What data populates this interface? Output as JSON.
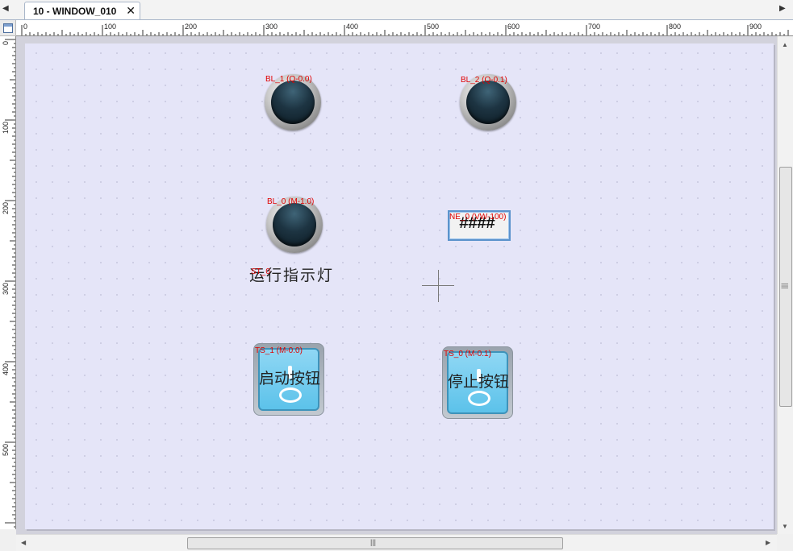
{
  "tab": {
    "title": "10 - WINDOW_010",
    "close": "✕"
  },
  "ruler": {
    "top_labels": [
      "0",
      "100",
      "200",
      "300",
      "400",
      "500",
      "600",
      "700",
      "800",
      "900"
    ],
    "left_labels": [
      "0",
      "100",
      "200",
      "300",
      "400",
      "500"
    ]
  },
  "widgets": {
    "bl1": {
      "label": "BL_1 (Q-0.0)"
    },
    "bl2": {
      "label": "BL_2 (Q-0.1)"
    },
    "bl0": {
      "label": "BL_0 (M-1.0)"
    },
    "ne0": {
      "label": "NE_0 (VW-100)",
      "value": "####"
    },
    "st0": {
      "label": "ST_0",
      "text": "运行指示灯"
    },
    "ts1": {
      "label": "TS_1 (M-0.0)",
      "text": "启动按钮"
    },
    "ts0": {
      "label": "TS_0 (M-0.1)",
      "text": "停止按钮"
    }
  },
  "scrollbars": {
    "grip_glyph": "|||"
  },
  "icons": {
    "tab_left": "triangle-left-icon",
    "tab_right": "triangle-right-icon",
    "corner": "window-icon"
  },
  "colors": {
    "label_red": "#e00000",
    "canvas_bg": "#e5e5f8",
    "switch_face": "#5cc2ea"
  }
}
